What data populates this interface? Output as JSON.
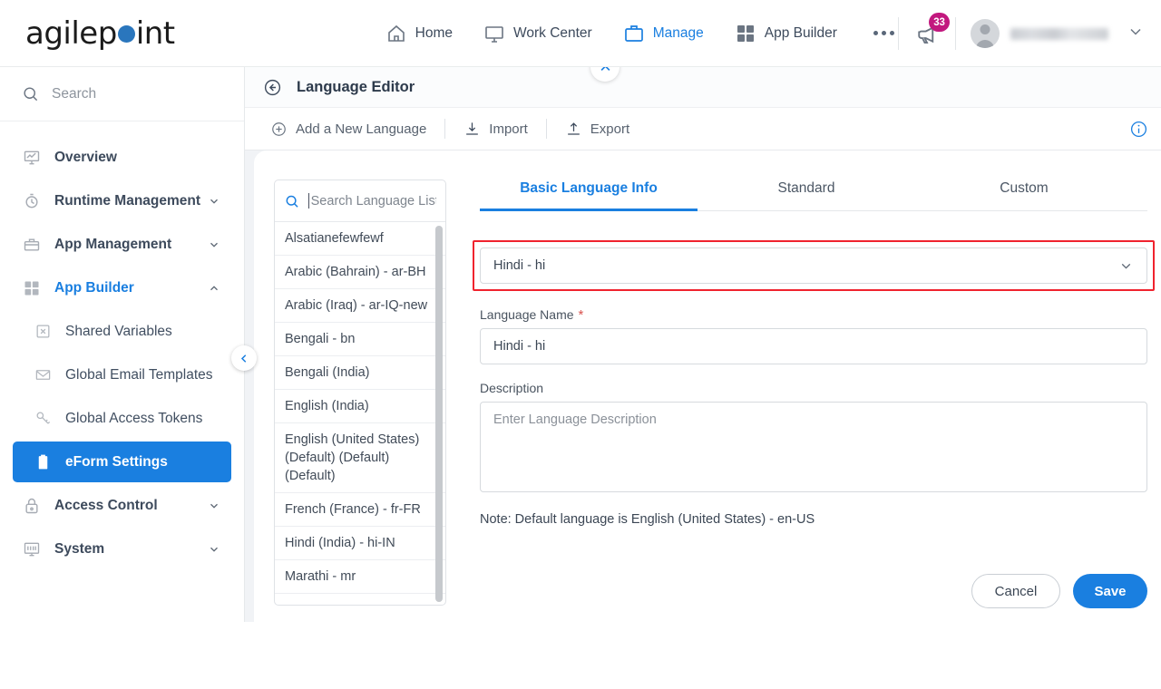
{
  "brand": {
    "logo_pre": "agilep",
    "logo_dot": "o",
    "logo_post": "int",
    "accent_color": "#2a76bd"
  },
  "topnav": {
    "items": [
      {
        "label": "Home",
        "icon": "home-icon",
        "active": false
      },
      {
        "label": "Work Center",
        "icon": "monitor-icon",
        "active": false
      },
      {
        "label": "Manage",
        "icon": "briefcase-icon",
        "active": true
      },
      {
        "label": "App Builder",
        "icon": "grid-icon",
        "active": false
      }
    ],
    "more_label": "...",
    "notification": {
      "icon": "megaphone-icon",
      "badge": "33",
      "badge_color": "#c2187e"
    },
    "user": {
      "name": "",
      "avatar_icon": "user-avatar-icon",
      "caret_icon": "chevron-down-icon"
    }
  },
  "sidebar": {
    "search": {
      "placeholder": "Search",
      "icon": "search-icon"
    },
    "items": [
      {
        "label": "Overview",
        "icon": "overview-icon",
        "level": 1,
        "expandable": false,
        "selected": false,
        "accent": false
      },
      {
        "label": "Runtime Management",
        "icon": "clock-icon",
        "level": 1,
        "expandable": true,
        "expanded": false,
        "selected": false,
        "accent": false
      },
      {
        "label": "App Management",
        "icon": "briefcase-icon",
        "level": 1,
        "expandable": true,
        "expanded": false,
        "selected": false,
        "accent": false
      },
      {
        "label": "App Builder",
        "icon": "grid-icon",
        "level": 1,
        "expandable": true,
        "expanded": true,
        "selected": false,
        "accent": true
      },
      {
        "label": "Shared Variables",
        "icon": "variable-icon",
        "level": 2,
        "expandable": false,
        "selected": false,
        "accent": false
      },
      {
        "label": "Global Email Templates",
        "icon": "envelope-icon",
        "level": 2,
        "expandable": false,
        "selected": false,
        "accent": false
      },
      {
        "label": "Global Access Tokens",
        "icon": "key-icon",
        "level": 2,
        "expandable": false,
        "selected": false,
        "accent": false
      },
      {
        "label": "eForm Settings",
        "icon": "clipboard-icon",
        "level": 2,
        "expandable": false,
        "selected": true,
        "accent": false
      },
      {
        "label": "Access Control",
        "icon": "lock-icon",
        "level": 1,
        "expandable": true,
        "expanded": false,
        "selected": false,
        "accent": false
      },
      {
        "label": "System",
        "icon": "system-icon",
        "level": 1,
        "expandable": true,
        "expanded": false,
        "selected": false,
        "accent": false
      }
    ],
    "collapse_handle_icon": "chevron-left-icon",
    "selected_bg": "#1a7fe0"
  },
  "page": {
    "back_icon": "back-arrow-icon",
    "title": "Language Editor",
    "collapse_icon": "chevron-up-icon",
    "toolbar": {
      "add_label": "Add a New Language",
      "add_icon": "plus-circle-icon",
      "import_label": "Import",
      "import_icon": "import-icon",
      "export_label": "Export",
      "export_icon": "export-icon",
      "info_icon": "info-icon"
    }
  },
  "language_list": {
    "search": {
      "placeholder": "Search Language List",
      "icon": "search-icon"
    },
    "items": [
      "Alsatianefewfewf",
      "Arabic (Bahrain) - ar-BH",
      "Arabic (Iraq) - ar-IQ-new",
      "Bengali - bn",
      "Bengali (India)",
      "English (India)",
      "English (United States) (Default) (Default) (Default)",
      "French (France) - fr-FR",
      "Hindi (India) - hi-IN",
      "Marathi - mr"
    ]
  },
  "form": {
    "tabs": [
      {
        "label": "Basic Language Info",
        "active": true
      },
      {
        "label": "Standard",
        "active": false
      },
      {
        "label": "Custom",
        "active": false
      }
    ],
    "language_select": {
      "value": "Hindi - hi",
      "caret_icon": "chevron-down-icon",
      "highlight_color": "#f0232e"
    },
    "language_name": {
      "label": "Language Name",
      "required_marker": "*",
      "value": "Hindi - hi"
    },
    "description": {
      "label": "Description",
      "placeholder": "Enter Language Description",
      "value": ""
    },
    "note": "Note: Default language is English (United States) - en-US",
    "buttons": {
      "cancel": "Cancel",
      "save": "Save"
    }
  }
}
